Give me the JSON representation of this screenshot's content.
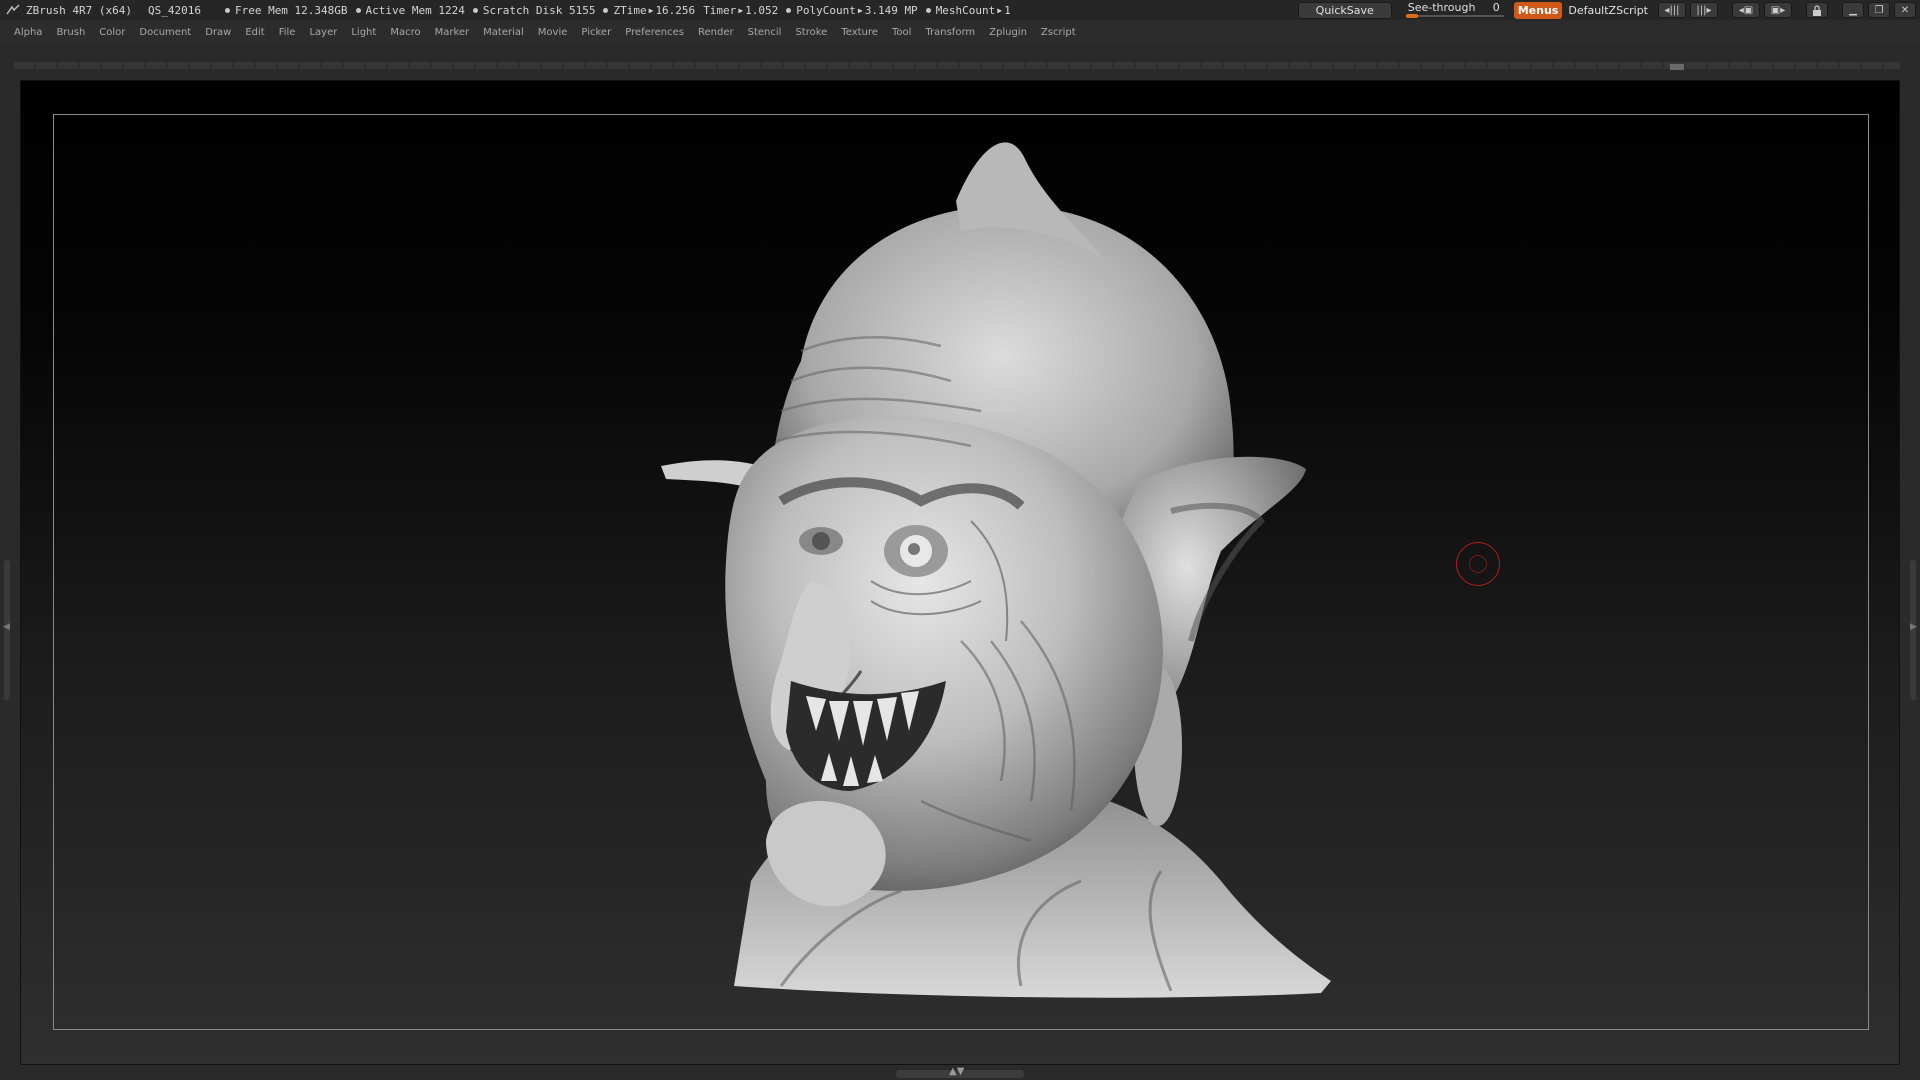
{
  "titlebar": {
    "app_title": "ZBrush 4R7 (x64)",
    "file_name": "QS_42016",
    "stats": [
      {
        "label": "Free Mem 12.348GB"
      },
      {
        "label": "Active Mem 1224"
      },
      {
        "label": "Scratch Disk 5155"
      }
    ],
    "ztime_label": "ZTime",
    "ztime_value": "16.256",
    "timer_label": "Timer",
    "timer_value": "1.052",
    "polycount_label": "PolyCount",
    "polycount_value": "3.149 MP",
    "meshcount_label": "MeshCount",
    "meshcount_value": "1",
    "quicksave_label": "QuickSave",
    "seethrough_label": "See-through",
    "seethrough_value": "0",
    "seethrough_fraction": 0,
    "menus_label": "Menus",
    "script_label": "DefaultZScript",
    "accent_color": "#d0591a"
  },
  "menubar": {
    "items": [
      "Alpha",
      "Brush",
      "Color",
      "Document",
      "Draw",
      "Edit",
      "File",
      "Layer",
      "Light",
      "Macro",
      "Marker",
      "Material",
      "Movie",
      "Picker",
      "Preferences",
      "Render",
      "Stencil",
      "Stroke",
      "Texture",
      "Tool",
      "Transform",
      "Zplugin",
      "Zscript"
    ]
  },
  "canvas": {
    "subject": "sculpted goblin head bust",
    "cursor_color": "#b21c1c"
  },
  "icons": {
    "logo": "zbrush-logo-icon",
    "minimize": "minimize-icon",
    "restore": "restore-icon",
    "close": "close-icon"
  }
}
